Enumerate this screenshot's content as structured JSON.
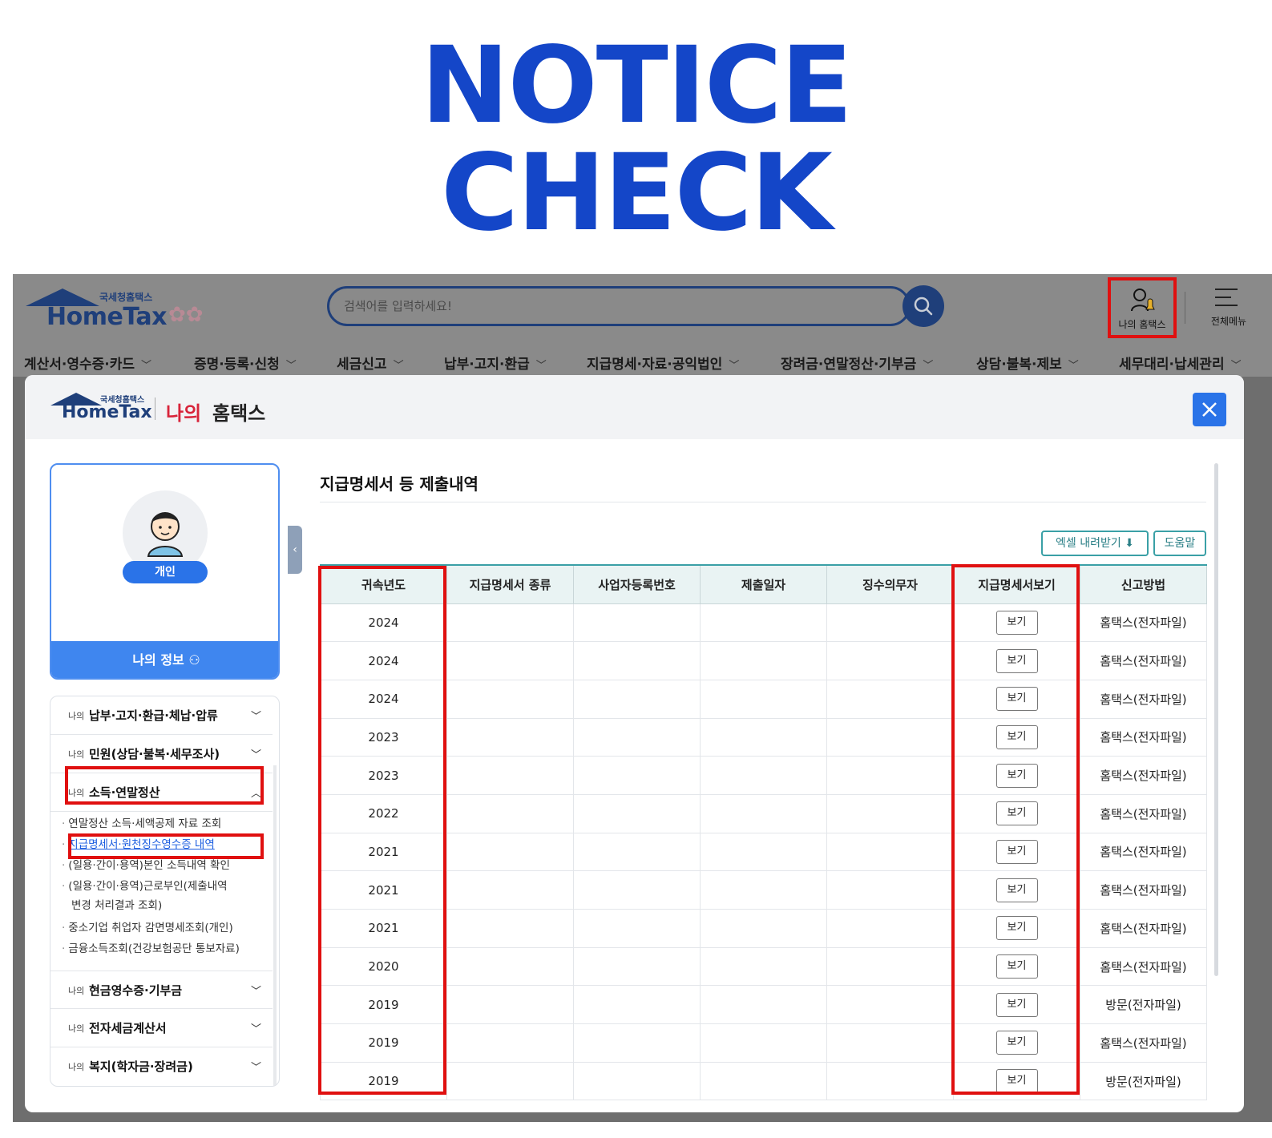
{
  "banner": {
    "line1": "NOTICE",
    "line2": "CHECK"
  },
  "header": {
    "logo_small": "국세청홈택스",
    "logo_big": "HomeTax",
    "search_placeholder": "검색어를 입력하세요!",
    "my_hometax": "나의 홈택스",
    "all_menu": "전체메뉴",
    "nav": [
      "계산서·영수증·카드",
      "증명·등록·신청",
      "세금신고",
      "납부·고지·환급",
      "지급명세·자료·공익법인",
      "장려금·연말정산·기부금",
      "상담·불복·제보",
      "세무대리·납세관리"
    ]
  },
  "modal": {
    "logo_small": "국세청홈택스",
    "logo_big": "HomeTax",
    "title_na": "나의",
    "title_rest": "홈택스",
    "profile": {
      "badge": "개인",
      "my_info": "나의 정보"
    },
    "menu_prefix": "나의",
    "menu_sections": [
      "납부·고지·환급·체납·압류",
      "민원(상담·불복·세무조사)",
      "소득·연말정산",
      "현금영수증·기부금",
      "전자세금계산서",
      "복지(학자금·장려금)"
    ],
    "submenu": [
      "연말정산 소득·세액공제 자료 조회",
      "지급명세서·원천징수영수증 내역",
      "(일용·간이·용역)본인 소득내역 확인",
      "(일용·간이·용역)근로부인(제출내역",
      "변경 처리결과 조회)",
      "중소기업 취업자 감면명세조회(개인)",
      "금융소득조회(건강보험공단 통보자료)"
    ],
    "content_title": "지급명세서 등 제출내역",
    "excel_button": "엑셀 내려받기",
    "help_button": "도움말",
    "table": {
      "headers": [
        "귀속년도",
        "지급명세서 종류",
        "사업자등록번호",
        "제출일자",
        "징수의무자",
        "지급명세서보기",
        "신고방법"
      ],
      "view_label": "보기",
      "rows": [
        {
          "year": "2024",
          "method": "홈택스(전자파일)"
        },
        {
          "year": "2024",
          "method": "홈택스(전자파일)"
        },
        {
          "year": "2024",
          "method": "홈택스(전자파일)"
        },
        {
          "year": "2023",
          "method": "홈택스(전자파일)"
        },
        {
          "year": "2023",
          "method": "홈택스(전자파일)"
        },
        {
          "year": "2022",
          "method": "홈택스(전자파일)"
        },
        {
          "year": "2021",
          "method": "홈택스(전자파일)"
        },
        {
          "year": "2021",
          "method": "홈택스(전자파일)"
        },
        {
          "year": "2021",
          "method": "홈택스(전자파일)"
        },
        {
          "year": "2020",
          "method": "홈택스(전자파일)"
        },
        {
          "year": "2019",
          "method": "방문(전자파일)"
        },
        {
          "year": "2019",
          "method": "홈택스(전자파일)"
        },
        {
          "year": "2019",
          "method": "방문(전자파일)"
        }
      ]
    }
  },
  "colors": {
    "banner": "#1446c8",
    "highlight": "#e01010",
    "accent": "#2a73e8",
    "teal": "#3aa0a6"
  }
}
